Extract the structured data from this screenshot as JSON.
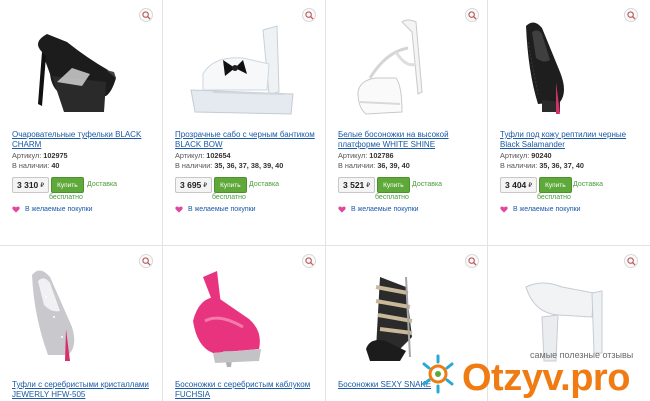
{
  "products": [
    {
      "title": "Очаровательные туфельки BLACK CHARM",
      "sku_label": "Артикул:",
      "sku": "102975",
      "stock_label": "В наличии:",
      "sizes": "40",
      "price": "3 310",
      "currency": "₽",
      "buy_label": "Купить",
      "delivery_line1": "Доставка",
      "delivery_line2": "бесплатно",
      "wishlist": "В желаемые покупки"
    },
    {
      "title": "Прозрачные сабо с черным бантиком BLACK BOW",
      "sku_label": "Артикул:",
      "sku": "102654",
      "stock_label": "В наличии:",
      "sizes": "35, 36, 37, 38, 39, 40",
      "price": "3 695",
      "currency": "₽",
      "buy_label": "Купить",
      "delivery_line1": "Доставка",
      "delivery_line2": "бесплатно",
      "wishlist": "В желаемые покупки"
    },
    {
      "title": "Белые босоножки на высокой платформе WHITE SHINE",
      "sku_label": "Артикул:",
      "sku": "102786",
      "stock_label": "В наличии:",
      "sizes": "36, 39, 40",
      "price": "3 521",
      "currency": "₽",
      "buy_label": "Купить",
      "delivery_line1": "Доставка",
      "delivery_line2": "бесплатно",
      "wishlist": "В желаемые покупки"
    },
    {
      "title": "Туфли под кожу рептилии черные Black Salamander",
      "sku_label": "Артикул:",
      "sku": "90240",
      "stock_label": "В наличии:",
      "sizes": "35, 36, 37, 40",
      "price": "3 404",
      "currency": "₽",
      "buy_label": "Купить",
      "delivery_line1": "Доставка",
      "delivery_line2": "бесплатно",
      "wishlist": "В желаемые покупки"
    },
    {
      "title": "Туфли с серебристыми кристаллами JEWERLY HFW-505"
    },
    {
      "title": "Босоножки с серебристым каблуком FUCHSIA"
    },
    {
      "title": "Босоножки SEXY SNAKE"
    },
    {
      "title": ""
    }
  ],
  "watermark": {
    "tagline": "самые полезные отзывы",
    "brand": "Otzyv.pro"
  },
  "colors": {
    "link": "#1a5aa8",
    "buy_button": "#5fa93a",
    "delivery": "#4a9c3a",
    "watermark_orange": "#f07b13",
    "heart_pink": "#e0479d",
    "fuchsia": "#e8347e"
  }
}
